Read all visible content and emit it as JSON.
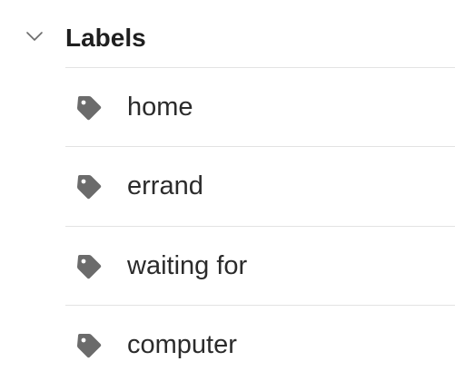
{
  "section": {
    "title": "Labels",
    "expanded": true,
    "chevron_icon": "chevron-down-icon"
  },
  "labels": [
    {
      "name": "home",
      "icon": "tag-icon"
    },
    {
      "name": "errand",
      "icon": "tag-icon"
    },
    {
      "name": "waiting for",
      "icon": "tag-icon"
    },
    {
      "name": "computer",
      "icon": "tag-icon"
    }
  ],
  "colors": {
    "text": "#2b2b2b",
    "title": "#1f1f1f",
    "icon": "#6b6b6b",
    "divider": "#e3e3e3"
  }
}
